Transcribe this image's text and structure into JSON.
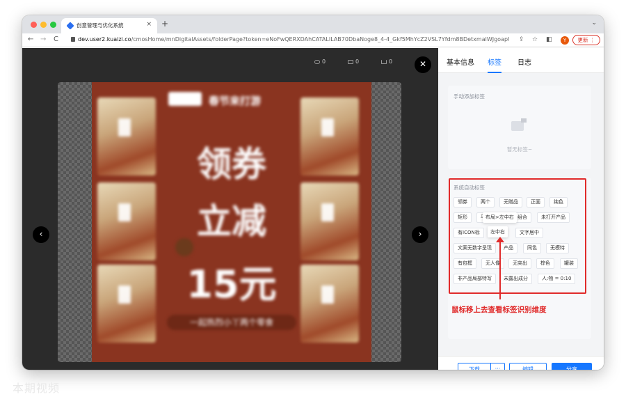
{
  "browser": {
    "tab_title": "创意管理与优化系统",
    "tab_close": "×",
    "new_tab": "+",
    "tab_menu": "⌄",
    "url_host": "dev.user2.kuaizi.co",
    "url_path": "/cmosHome/mnDigitalAssets/folderPage?token=eNoFwQERXDAhCATALILAB70DbaNoge8_4-4_Gkf5MhYcZ2VSL7Yfdm8BDetxmalWJgoapUot8...",
    "nav_back": "←",
    "nav_forward": "→",
    "nav_reload": "C",
    "avatar_letter": "Y",
    "update_label": "更新"
  },
  "viewer": {
    "view_count": "0",
    "share_count": "0",
    "download_count": "0",
    "close_icon": "✕",
    "prev_icon": "‹",
    "next_icon": "›",
    "poster": {
      "header_text": "春节来打游",
      "line1": "领券",
      "line2": "立减",
      "line3": "15元",
      "footer_text": "一起热烈小丫两个零食"
    }
  },
  "panel": {
    "tabs": [
      {
        "label": "基本信息",
        "active": false
      },
      {
        "label": "标签",
        "active": true
      },
      {
        "label": "日志",
        "active": false
      }
    ],
    "manual_title": "手动添加标签",
    "manual_empty": "暂无标签~",
    "auto_title": "系统自动标签",
    "auto_tags": [
      "领券",
      "两个",
      "无赠品",
      "正面",
      "纯色",
      "矩形",
      "平",
      "组合",
      "未打开产品",
      "有ICON标",
      "文字居中",
      "文案无数字呈现",
      "产品",
      "同色",
      "无模特",
      "有包框",
      "无人像",
      "无突出",
      "棕色",
      "罐装",
      "非产品局部特写",
      "未露出成分",
      "人:物 = 0:10"
    ],
    "tooltip_outer": "布局>左中右",
    "tooltip_inner": "左中右",
    "callout": "鼠标移上去查看标签识别维度",
    "buttons": {
      "download": "下载",
      "more": "···",
      "edit": "编辑",
      "share": "分享"
    }
  },
  "colors": {
    "accent": "#1677ff",
    "annotation": "#e02a2a",
    "poster_bg": "#8a3420"
  },
  "watermark": "本期视频"
}
